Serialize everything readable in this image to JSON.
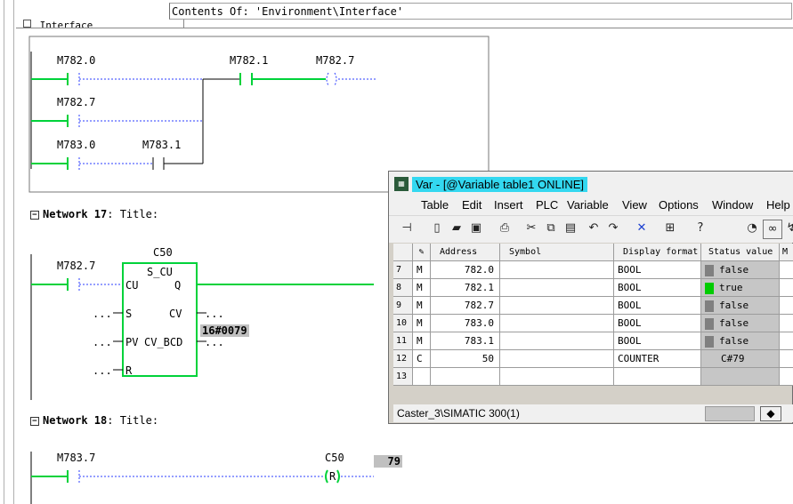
{
  "header": {
    "contents_label": "Contents Of: 'Environment\\Interface'",
    "tree_item": "Interface"
  },
  "network16": {
    "contacts": [
      "M782.0",
      "M782.7",
      "M783.0",
      "M783.1"
    ],
    "coils": [
      "M782.1",
      "M782.7"
    ]
  },
  "network17": {
    "title": "Network 17",
    "title_suffix": ": Title:",
    "counter": "C50",
    "block_name": "S_CU",
    "contact": "M782.7",
    "pin_cu": "CU",
    "pin_s": "S",
    "pin_pv": "PV",
    "pin_r": "R",
    "pin_q": "Q",
    "pin_cv": "CV",
    "pin_cv_bcd": "CV_BCD",
    "dots": "...",
    "cv_bcd_value": "16#0079"
  },
  "network18": {
    "title": "Network 18",
    "title_suffix": ": Title:",
    "contact": "M783.7",
    "counter": "C50",
    "coil_letter": "R",
    "value": "79"
  },
  "var_window": {
    "title": "Var - [@Variable table1 ONLINE]",
    "menu": [
      "Table",
      "Edit",
      "Insert",
      "PLC",
      "Variable",
      "View",
      "Options",
      "Window",
      "Help"
    ],
    "columns": [
      "",
      "Address",
      "Symbol",
      "Display format",
      "Status value",
      "M"
    ],
    "rows": [
      {
        "num": "7",
        "area": "M",
        "addr": "782.0",
        "symbol": "",
        "format": "BOOL",
        "status": "false"
      },
      {
        "num": "8",
        "area": "M",
        "addr": "782.1",
        "symbol": "",
        "format": "BOOL",
        "status": "true"
      },
      {
        "num": "9",
        "area": "M",
        "addr": "782.7",
        "symbol": "",
        "format": "BOOL",
        "status": "false"
      },
      {
        "num": "10",
        "area": "M",
        "addr": "783.0",
        "symbol": "",
        "format": "BOOL",
        "status": "false"
      },
      {
        "num": "11",
        "area": "M",
        "addr": "783.1",
        "symbol": "",
        "format": "BOOL",
        "status": "false"
      },
      {
        "num": "12",
        "area": "C",
        "addr": "50",
        "symbol": "",
        "format": "COUNTER",
        "status": "C#79"
      },
      {
        "num": "13",
        "area": "",
        "addr": "",
        "symbol": "",
        "format": "",
        "status": ""
      }
    ],
    "status_bar": "Caster_3\\SIMATIC 300(1)"
  },
  "colors": {
    "power_flow": "#00d23a",
    "title_highlight": "#33d8f0",
    "status_true": "#00cc00",
    "status_false": "#808080"
  }
}
